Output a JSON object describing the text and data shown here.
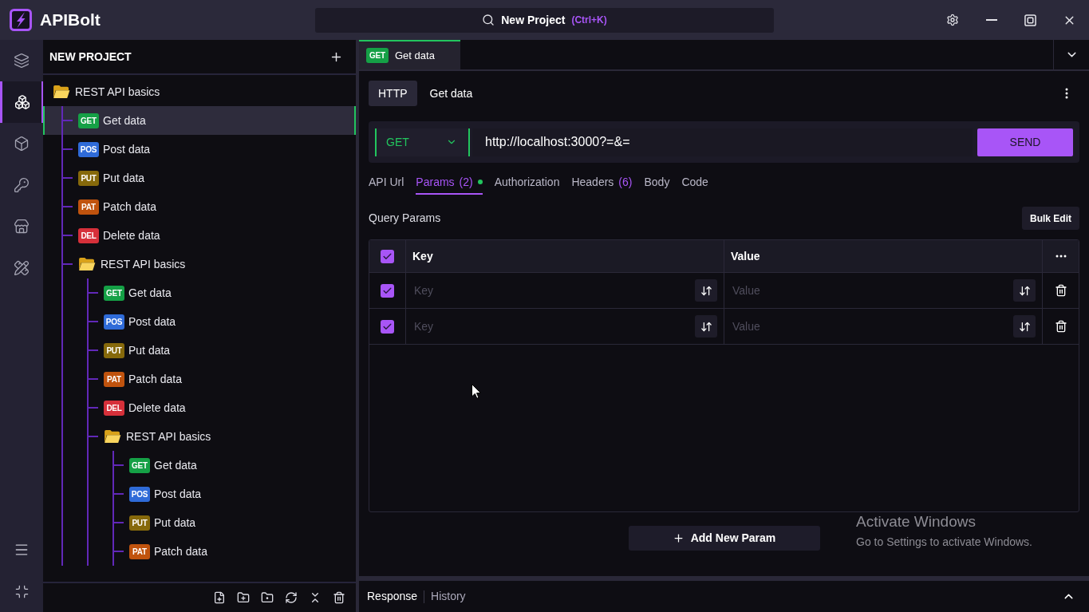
{
  "app": {
    "name": "APIBolt"
  },
  "search": {
    "label": "New Project",
    "shortcut": "(Ctrl+K)"
  },
  "nav_rail": [
    {
      "selected": false
    },
    {
      "selected": true
    },
    {
      "selected": false
    },
    {
      "selected": false
    },
    {
      "selected": false
    },
    {
      "selected": false
    }
  ],
  "sidebar": {
    "title": "NEW PROJECT",
    "tree": [
      {
        "kind": "folder",
        "label": "REST API basics",
        "expanded": true,
        "selected": false,
        "children": [
          {
            "kind": "request",
            "method": "GET",
            "color": "#15a046",
            "label": "Get data",
            "selected": true
          },
          {
            "kind": "request",
            "method": "POS",
            "color": "#2f6bd8",
            "label": "Post data",
            "selected": false
          },
          {
            "kind": "request",
            "method": "PUT",
            "color": "#86690b",
            "label": "Put data",
            "selected": false
          },
          {
            "kind": "request",
            "method": "PAT",
            "color": "#c0530e",
            "label": "Patch data",
            "selected": false
          },
          {
            "kind": "request",
            "method": "DEL",
            "color": "#d6303a",
            "label": "Delete data",
            "selected": false
          },
          {
            "kind": "folder",
            "label": "REST API basics",
            "expanded": true,
            "selected": false,
            "children": [
              {
                "kind": "request",
                "method": "GET",
                "color": "#15a046",
                "label": "Get data",
                "selected": false
              },
              {
                "kind": "request",
                "method": "POS",
                "color": "#2f6bd8",
                "label": "Post data",
                "selected": false
              },
              {
                "kind": "request",
                "method": "PUT",
                "color": "#86690b",
                "label": "Put data",
                "selected": false
              },
              {
                "kind": "request",
                "method": "PAT",
                "color": "#c0530e",
                "label": "Patch data",
                "selected": false
              },
              {
                "kind": "request",
                "method": "DEL",
                "color": "#d6303a",
                "label": "Delete data",
                "selected": false
              },
              {
                "kind": "folder",
                "label": "REST API basics",
                "expanded": true,
                "selected": false,
                "children": [
                  {
                    "kind": "request",
                    "method": "GET",
                    "color": "#15a046",
                    "label": "Get data",
                    "selected": false
                  },
                  {
                    "kind": "request",
                    "method": "POS",
                    "color": "#2f6bd8",
                    "label": "Post data",
                    "selected": false
                  },
                  {
                    "kind": "request",
                    "method": "PUT",
                    "color": "#86690b",
                    "label": "Put data",
                    "selected": false
                  },
                  {
                    "kind": "request",
                    "method": "PAT",
                    "color": "#c0530e",
                    "label": "Patch data",
                    "selected": false
                  }
                ]
              }
            ]
          }
        ]
      }
    ]
  },
  "open_tabs": [
    {
      "method": "GET",
      "color": "#15a046",
      "label": "Get data",
      "selected": true
    }
  ],
  "request": {
    "protocol": "HTTP",
    "name": "Get data",
    "method": "GET",
    "color": "#22c55e",
    "url": "http://localhost:3000?=&=",
    "send": "SEND"
  },
  "request_tabs": [
    {
      "label": "API Url",
      "selected": false,
      "indicator": false
    },
    {
      "label": "Params",
      "count": "(2)",
      "selected": true,
      "indicator": true
    },
    {
      "label": "Authorization",
      "selected": false,
      "indicator": false
    },
    {
      "label": "Headers",
      "count": "(6)",
      "selected": false,
      "indicator": false
    },
    {
      "label": "Body",
      "selected": false,
      "indicator": false
    },
    {
      "label": "Code",
      "selected": false,
      "indicator": false
    }
  ],
  "query_params": {
    "title": "Query Params",
    "bulk_edit": "Bulk Edit",
    "all_checked": true,
    "columns": [
      "Key",
      "Value"
    ],
    "rows": [
      {
        "checked": true,
        "key": {
          "placeholder": "Key"
        },
        "value": {
          "placeholder": "Value"
        }
      },
      {
        "checked": true,
        "key": {
          "placeholder": "Key"
        },
        "value": {
          "placeholder": "Value"
        }
      }
    ],
    "add_button": "Add New Param"
  },
  "bottom_panel": {
    "tabs": [
      {
        "label": "Response",
        "selected": true
      },
      {
        "label": "History",
        "selected": false
      }
    ],
    "expanded": false
  },
  "system_notice": {
    "title": "Activate Windows",
    "text": "Go to Settings to activate Windows."
  }
}
